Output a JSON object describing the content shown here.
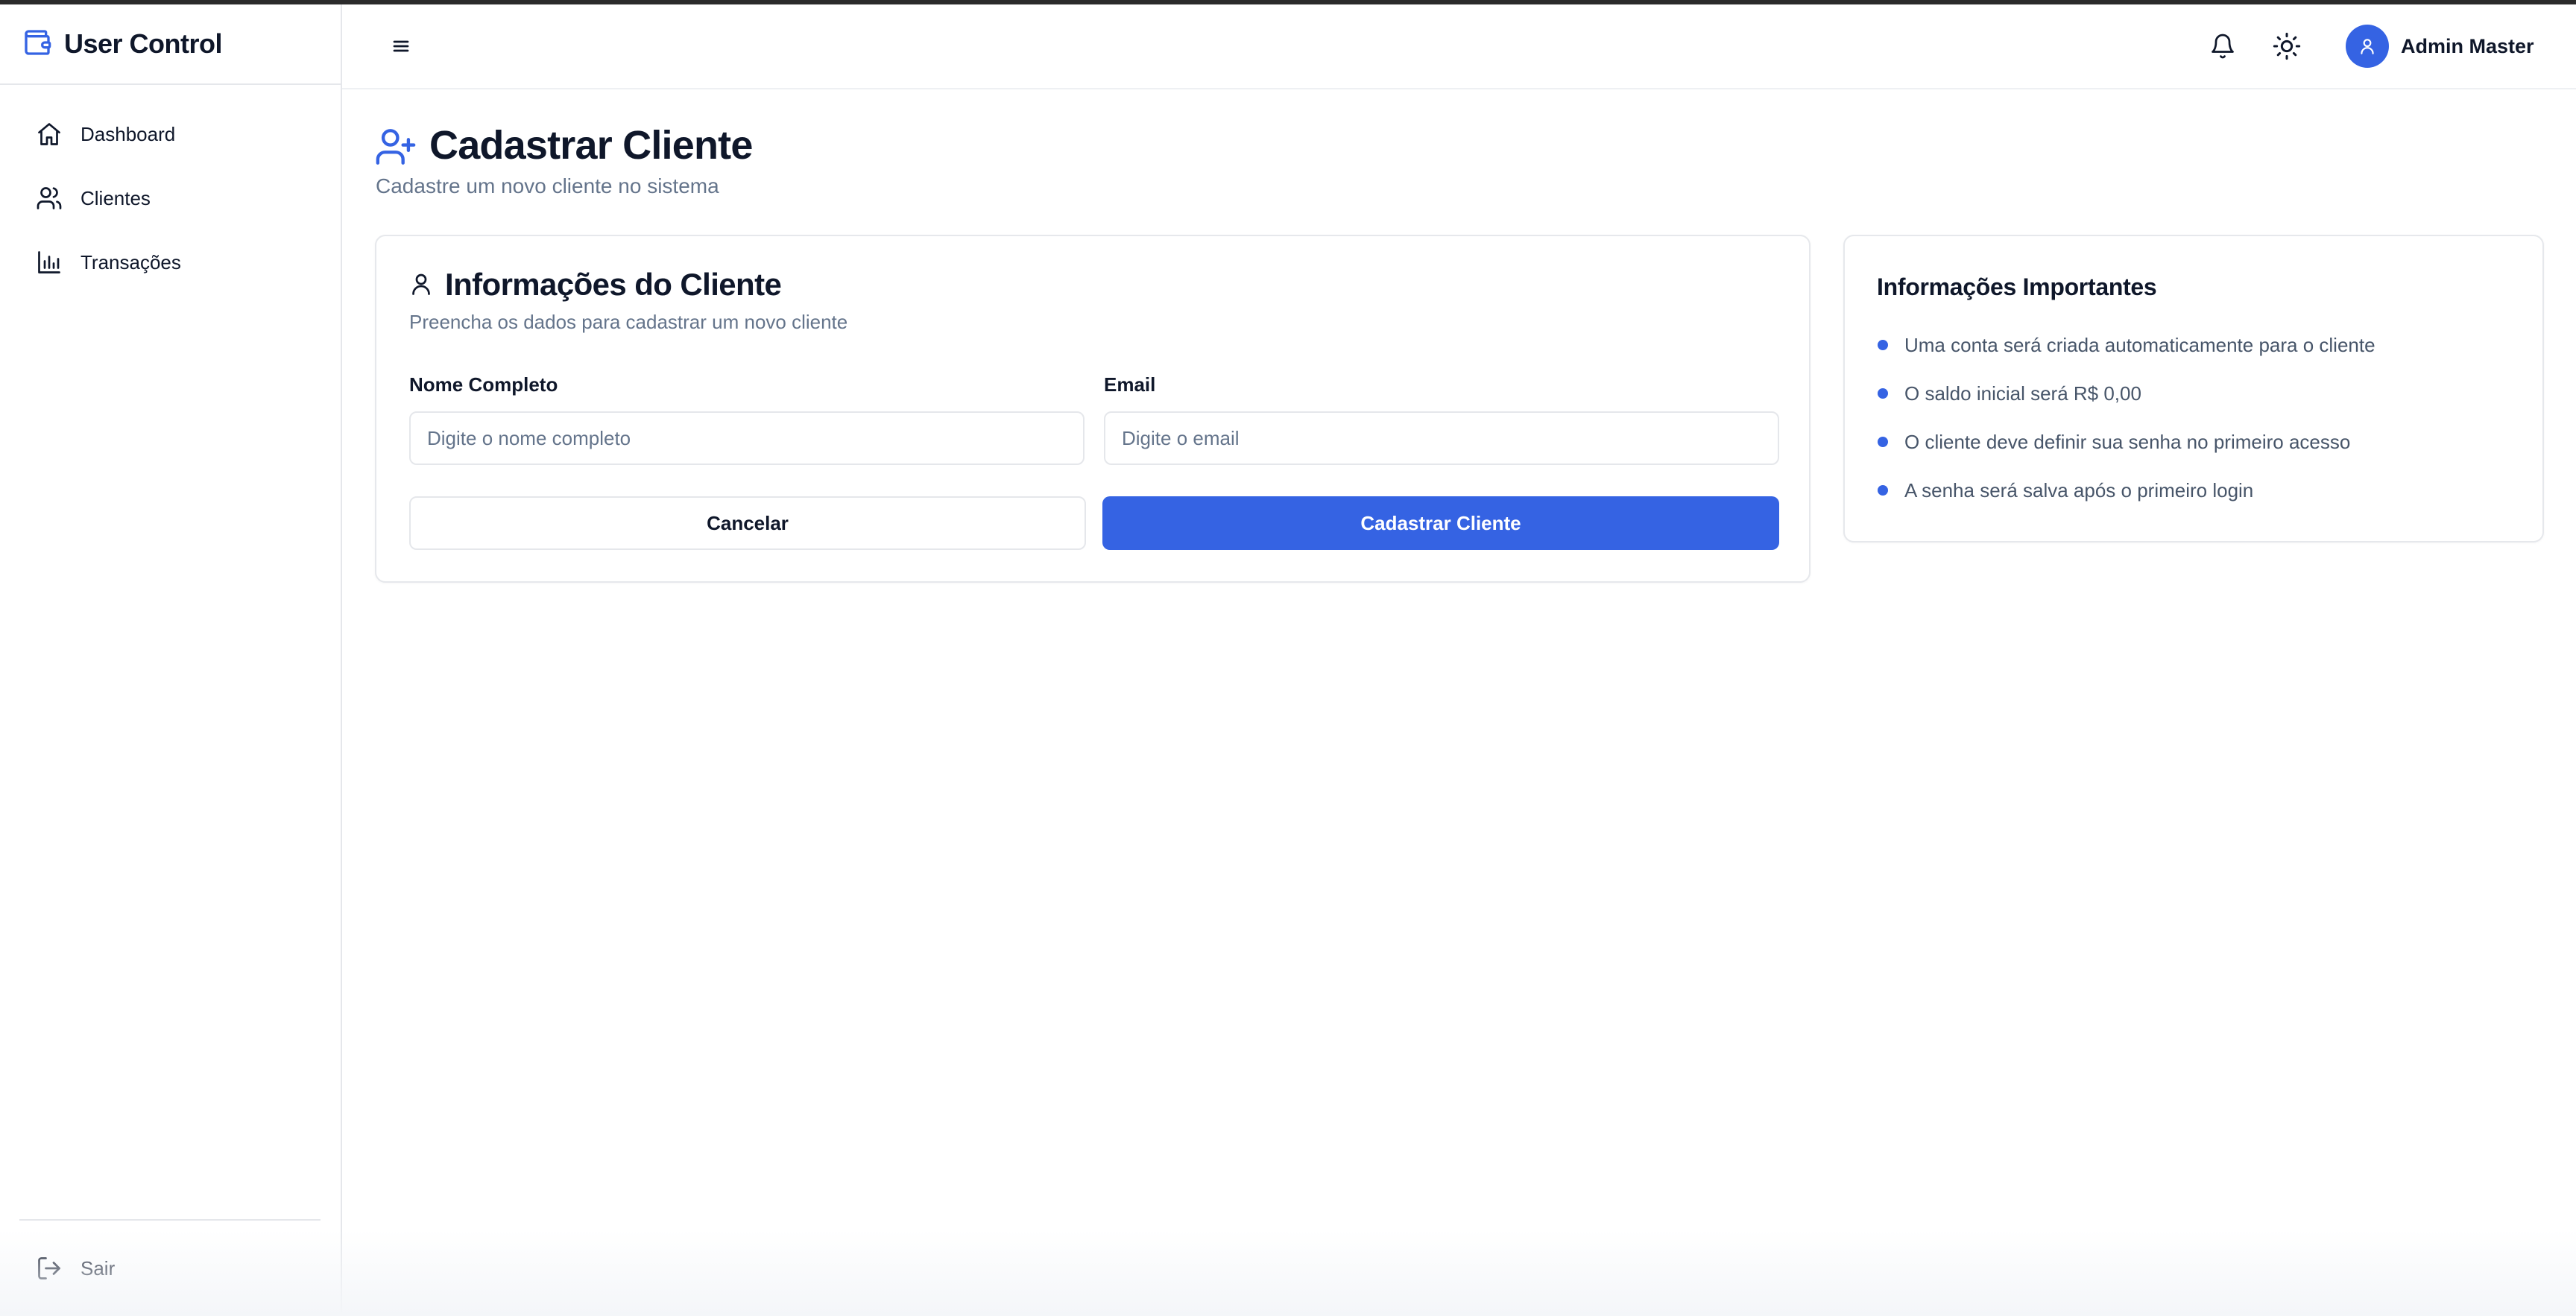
{
  "app": {
    "title": "User Control",
    "accent_color": "#3563e3",
    "brand_icon": "wallet-icon"
  },
  "sidebar": {
    "items": [
      {
        "label": "Dashboard",
        "icon": "home-icon"
      },
      {
        "label": "Clientes",
        "icon": "users-icon"
      },
      {
        "label": "Transações",
        "icon": "bar-chart-icon"
      }
    ],
    "logout": {
      "label": "Sair",
      "icon": "log-out-icon"
    }
  },
  "header": {
    "menu_icon": "menu-icon",
    "notifications_icon": "bell-icon",
    "theme_icon": "sun-icon",
    "user": {
      "name": "Admin Master",
      "avatar_icon": "user-icon"
    }
  },
  "page": {
    "title": "Cadastrar Cliente",
    "subtitle": "Cadastre um novo cliente no sistema",
    "icon": "user-plus-icon"
  },
  "form": {
    "title": "Informações do Cliente",
    "description": "Preencha os dados para cadastrar um novo cliente",
    "fields": [
      {
        "label": "Nome Completo",
        "placeholder": "Digite o nome completo",
        "value": ""
      },
      {
        "label": "Email",
        "placeholder": "Digite o email",
        "value": ""
      }
    ],
    "cancel_label": "Cancelar",
    "submit_label": "Cadastrar Cliente"
  },
  "info": {
    "title": "Informações Importantes",
    "items": [
      "Uma conta será criada automaticamente para o cliente",
      "O saldo inicial será R$ 0,00",
      "O cliente deve definir sua senha no primeiro acesso",
      "A senha será salva após o primeiro login"
    ]
  }
}
